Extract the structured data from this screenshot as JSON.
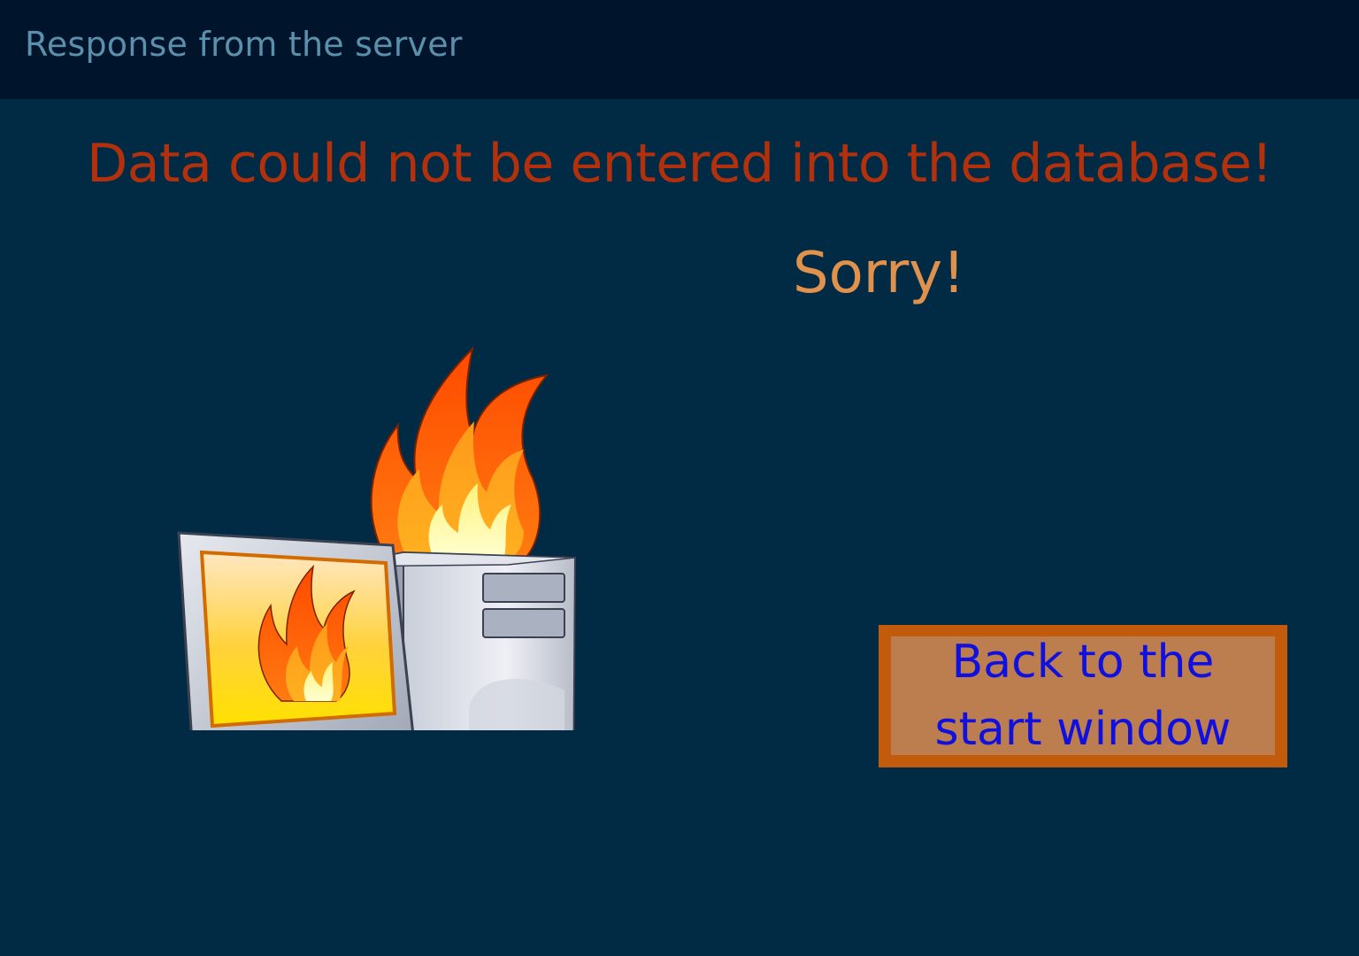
{
  "window": {
    "title": "Response from the server"
  },
  "message": {
    "error": "Data could not be entered into the database!",
    "apology": "Sorry!"
  },
  "illustration": {
    "icon": "burning-computer-icon"
  },
  "actions": {
    "back_label": "Back to the start window"
  },
  "colors": {
    "titlebar_bg": "#00152b",
    "page_bg": "#012b45",
    "title_text": "#5b90ad",
    "error_text": "#b2300c",
    "apology_text": "#e0914c",
    "button_border": "#c25b0b",
    "button_fill": "#bc7d4f",
    "button_text": "#1010e0"
  }
}
